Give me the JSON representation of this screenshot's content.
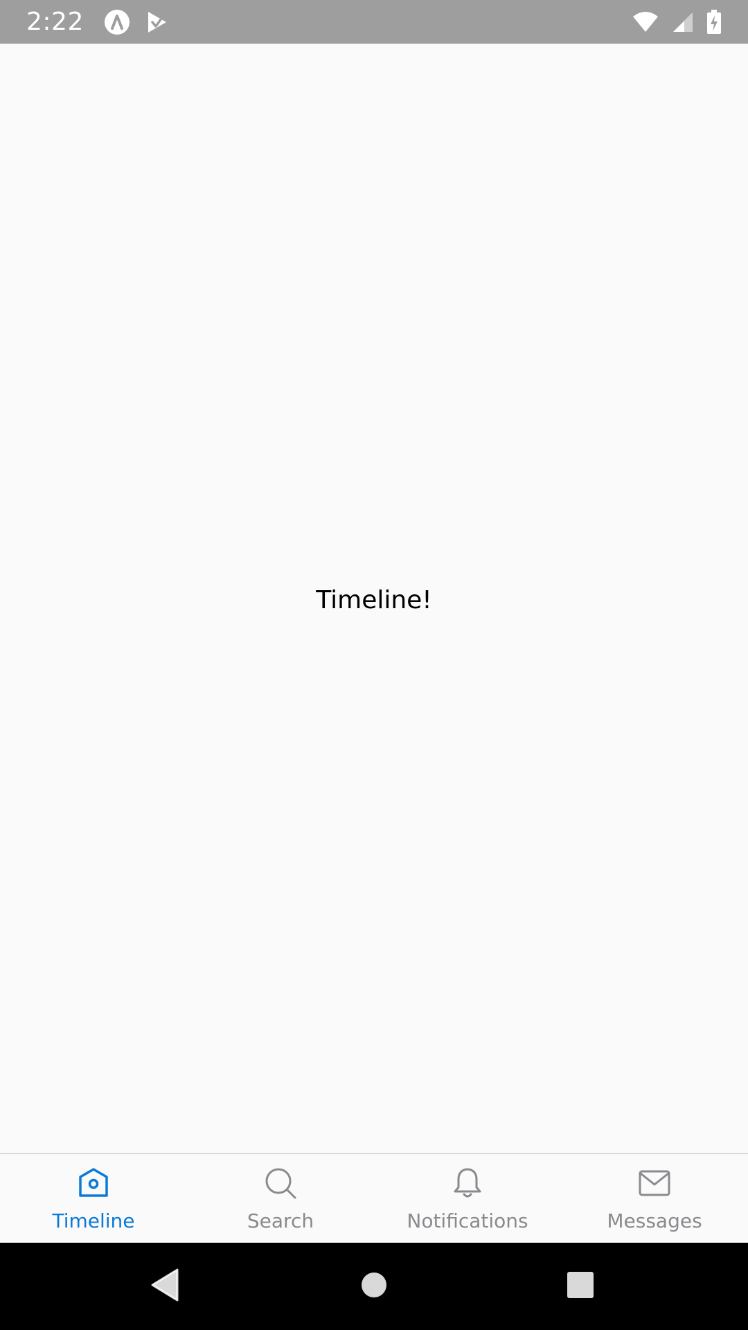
{
  "status_bar": {
    "time": "2:22",
    "background": "#9e9e9e",
    "left_icons": [
      "android-studio-icon",
      "play-store-icon"
    ],
    "right_icons": [
      "wifi-icon",
      "cellular-signal-icon",
      "battery-charging-icon"
    ]
  },
  "main": {
    "text": "Timeline!"
  },
  "tab_bar": {
    "active_color": "#0a7ad6",
    "inactive_color": "#8a8a8e",
    "tabs": [
      {
        "label": "Timeline",
        "icon": "home-icon",
        "active": true
      },
      {
        "label": "Search",
        "icon": "search-icon",
        "active": false
      },
      {
        "label": "Notifications",
        "icon": "bell-icon",
        "active": false
      },
      {
        "label": "Messages",
        "icon": "mail-icon",
        "active": false
      }
    ]
  },
  "nav_bar": {
    "buttons": [
      "back-button",
      "home-button",
      "recents-button"
    ]
  }
}
